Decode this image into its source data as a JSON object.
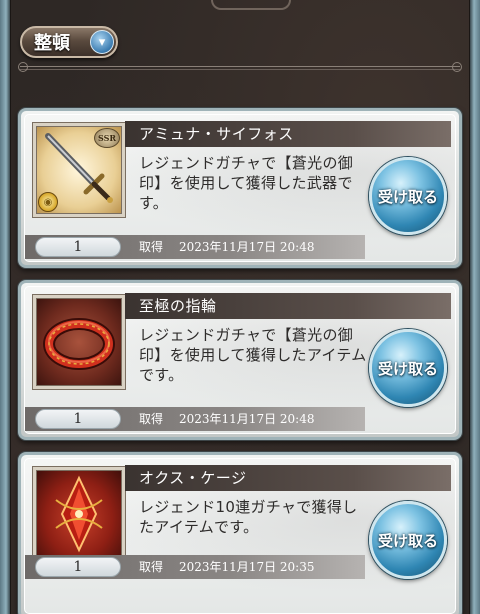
{
  "header": {
    "sort_label": "整頓",
    "sort_icon": "chevron-down-icon"
  },
  "items": [
    {
      "name": "アミュナ・サイフォス",
      "description": "レジェンドガチャで【蒼光の御印】を使用して獲得した武器です。",
      "quantity": "1",
      "acquired_label": "取得",
      "acquired_date": "2023年11月17日 20:48",
      "receive_label": "受け取る",
      "rarity_badge": "SSR",
      "thumbnail_icon": "sword-icon"
    },
    {
      "name": "至極の指輪",
      "description": "レジェンドガチャで【蒼光の御印】を使用して獲得したアイテムです。",
      "quantity": "1",
      "acquired_label": "取得",
      "acquired_date": "2023年11月17日 20:48",
      "receive_label": "受け取る",
      "thumbnail_icon": "ring-icon"
    },
    {
      "name": "オクス・ケージ",
      "description": "レジェンド10連ガチャで獲得したアイテムです。",
      "quantity": "1",
      "acquired_label": "取得",
      "acquired_date": "2023年11月17日 20:35",
      "receive_label": "受け取る",
      "thumbnail_icon": "crystal-icon"
    }
  ],
  "colors": {
    "receive_button": "#2f86b3",
    "title_bar": "#3a3330",
    "background": "#2e2825"
  }
}
